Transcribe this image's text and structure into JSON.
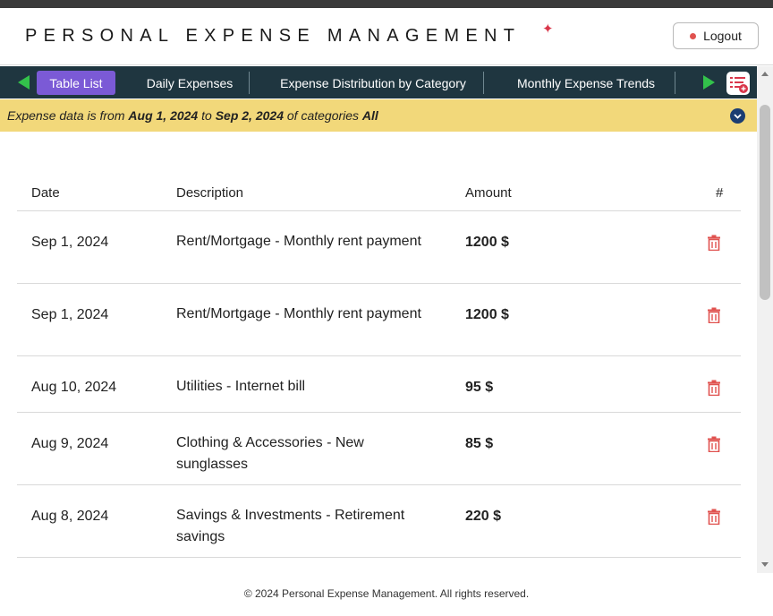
{
  "header": {
    "title": "PERSONAL EXPENSE MANAGEMENT",
    "logout_label": "Logout"
  },
  "nav": {
    "tabs": [
      {
        "label": "Table List",
        "active": true
      },
      {
        "label": "Daily Expenses",
        "active": false
      },
      {
        "label": "Expense Distribution by Category",
        "active": false
      },
      {
        "label": "Monthly Expense Trends",
        "active": false
      }
    ]
  },
  "banner": {
    "prefix": "Expense data is from ",
    "from_date": "Aug 1, 2024",
    "to_word": " to ",
    "to_date": "Sep 2, 2024",
    "of_categories": " of categories ",
    "categories": "All"
  },
  "table": {
    "headers": {
      "date": "Date",
      "description": "Description",
      "amount": "Amount",
      "actions": "#"
    },
    "rows": [
      {
        "date": "Sep 1, 2024",
        "description": "Rent/Mortgage - Monthly rent payment",
        "amount": "1200 $"
      },
      {
        "date": "Sep 1, 2024",
        "description": "Rent/Mortgage - Monthly rent payment",
        "amount": "1200 $"
      },
      {
        "date": "Aug 10, 2024",
        "description": "Utilities - Internet bill",
        "amount": "95 $"
      },
      {
        "date": "Aug 9, 2024",
        "description": "Clothing & Accessories - New sunglasses",
        "amount": "85 $"
      },
      {
        "date": "Aug 8, 2024",
        "description": "Savings & Investments - Retirement savings",
        "amount": "220 $"
      }
    ]
  },
  "footer": {
    "text": "© 2024 Personal Expense Management. All rights reserved."
  },
  "colors": {
    "nav_bg": "#1f3640",
    "active_tab": "#7b5ad6",
    "banner_bg": "#f2d87a",
    "arrow": "#33c24b",
    "delete": "#e0524f"
  }
}
